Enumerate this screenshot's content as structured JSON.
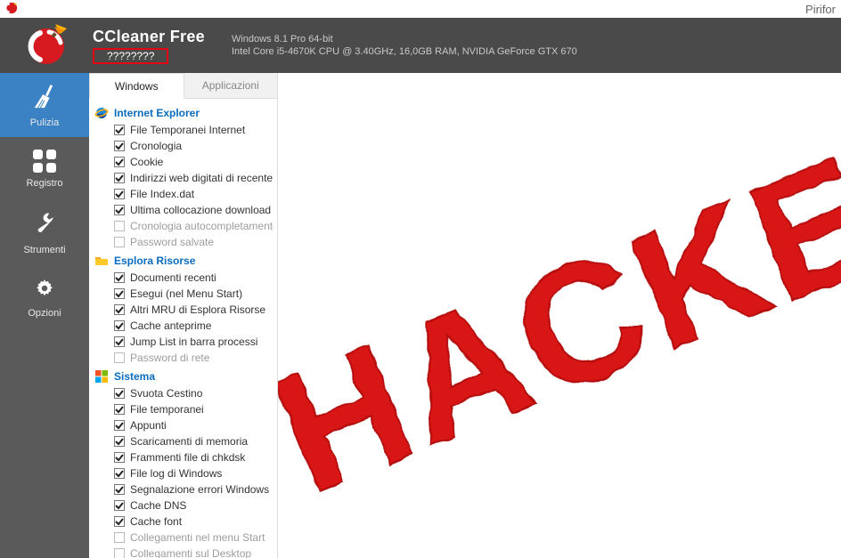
{
  "titlebar": {
    "vendor": "Pirifor"
  },
  "header": {
    "app_title": "CCleaner Free",
    "version_text": "????????",
    "sysinfo_line1": "Windows 8.1 Pro 64-bit",
    "sysinfo_line2": "Intel Core i5-4670K CPU @ 3.40GHz, 16,0GB RAM, NVIDIA GeForce GTX 670"
  },
  "sidebar": {
    "items": [
      {
        "key": "pulizia",
        "label": "Pulizia",
        "icon": "broom-icon",
        "active": true
      },
      {
        "key": "registro",
        "label": "Registro",
        "icon": "registry-grid-icon",
        "active": false
      },
      {
        "key": "strumenti",
        "label": "Strumenti",
        "icon": "wrench-icon",
        "active": false
      },
      {
        "key": "opzioni",
        "label": "Opzioni",
        "icon": "gear-icon",
        "active": false
      }
    ]
  },
  "tabs": {
    "windows": "Windows",
    "applicazioni": "Applicazioni"
  },
  "groups": [
    {
      "title": "Internet Explorer",
      "icon": "ie-icon",
      "items": [
        {
          "label": "File Temporanei Internet",
          "checked": true
        },
        {
          "label": "Cronologia",
          "checked": true
        },
        {
          "label": "Cookie",
          "checked": true
        },
        {
          "label": "Indirizzi web digitati di recente",
          "checked": true
        },
        {
          "label": "File Index.dat",
          "checked": true
        },
        {
          "label": "Ultima collocazione download",
          "checked": true
        },
        {
          "label": "Cronologia autocompletamento mo",
          "checked": false,
          "disabled": true
        },
        {
          "label": "Password salvate",
          "checked": false,
          "disabled": true
        }
      ]
    },
    {
      "title": "Esplora Risorse",
      "icon": "folder-icon",
      "items": [
        {
          "label": "Documenti recenti",
          "checked": true
        },
        {
          "label": "Esegui (nel Menu Start)",
          "checked": true
        },
        {
          "label": "Altri MRU di Esplora Risorse",
          "checked": true
        },
        {
          "label": "Cache anteprime",
          "checked": true
        },
        {
          "label": "Jump List in barra processi",
          "checked": true
        },
        {
          "label": "Password di rete",
          "checked": false,
          "disabled": true
        }
      ]
    },
    {
      "title": "Sistema",
      "icon": "windows-icon",
      "items": [
        {
          "label": "Svuota Cestino",
          "checked": true
        },
        {
          "label": "File temporanei",
          "checked": true
        },
        {
          "label": "Appunti",
          "checked": true
        },
        {
          "label": "Scaricamenti di memoria",
          "checked": true
        },
        {
          "label": "Frammenti file di chkdsk",
          "checked": true
        },
        {
          "label": "File log di Windows",
          "checked": true
        },
        {
          "label": "Segnalazione errori Windows",
          "checked": true
        },
        {
          "label": "Cache DNS",
          "checked": true
        },
        {
          "label": "Cache font",
          "checked": true
        },
        {
          "label": "Collegamenti nel menu Start",
          "checked": false,
          "disabled": true
        },
        {
          "label": "Collegamenti sul Desktop",
          "checked": false,
          "disabled": true
        }
      ]
    }
  ],
  "overlay": {
    "stamp_text": "HACKED",
    "stamp_color": "#d91414"
  }
}
